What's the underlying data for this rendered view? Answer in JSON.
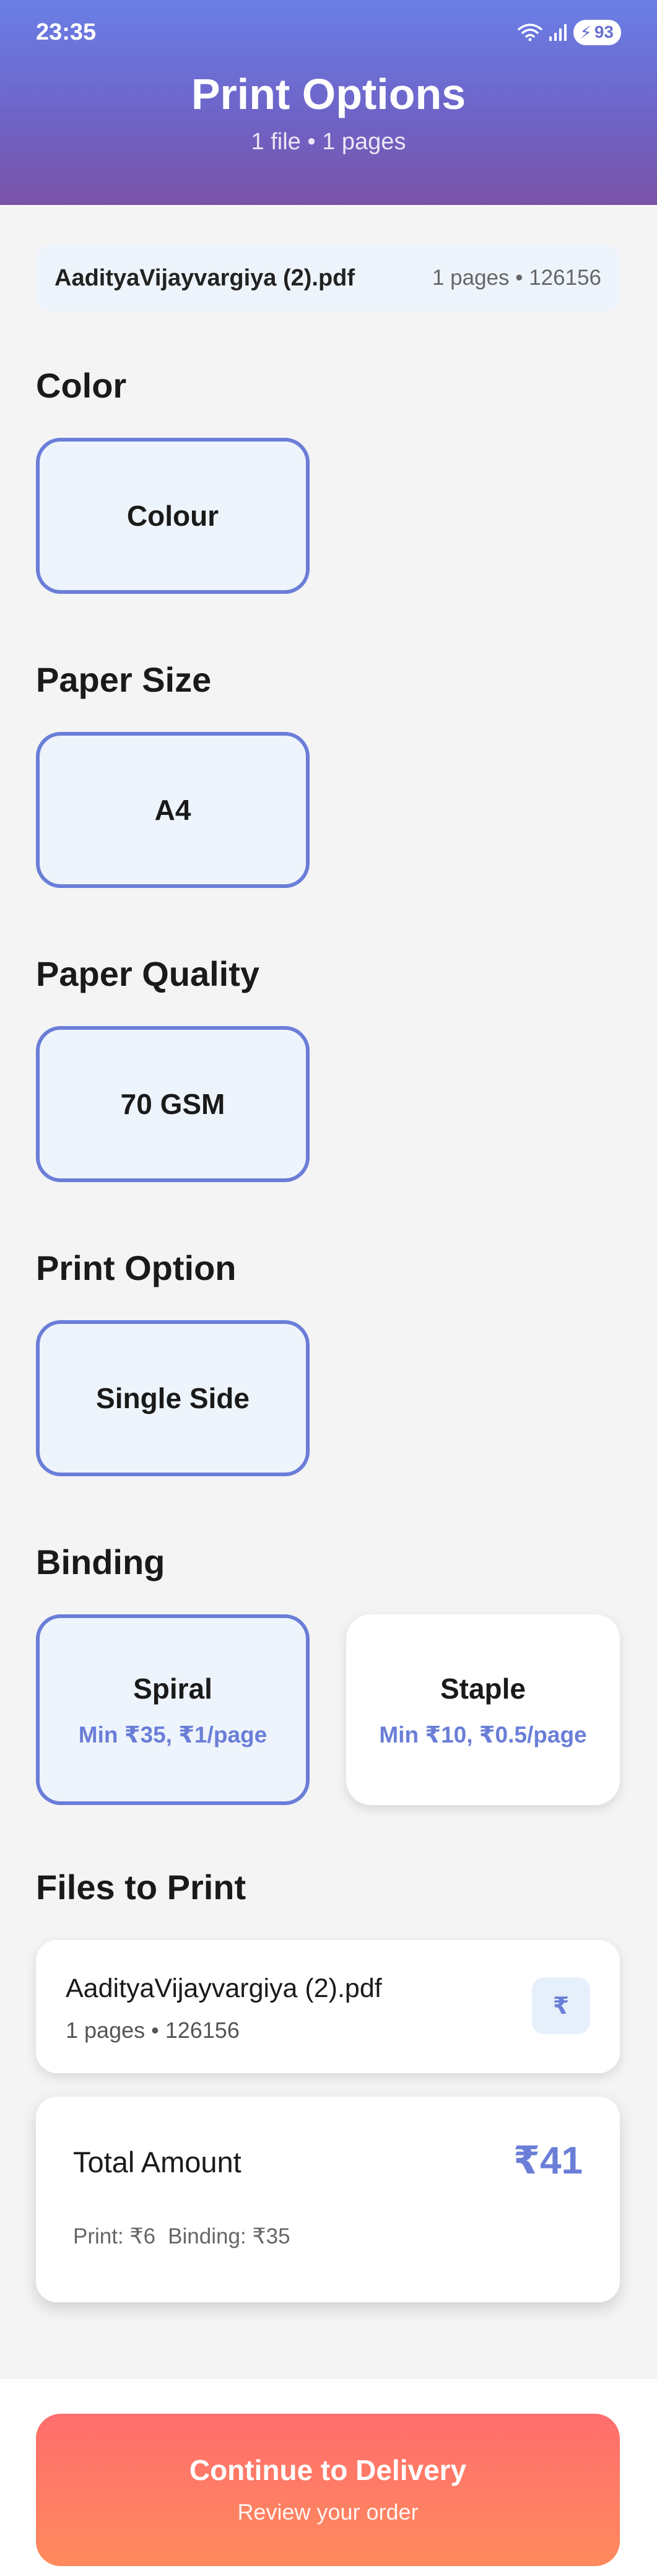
{
  "status_bar": {
    "time": "23:35",
    "battery": "93"
  },
  "header": {
    "title": "Print Options",
    "subtitle": "1 file • 1 pages"
  },
  "file_summary": {
    "name": "AadityaVijayvargiya (2).pdf",
    "meta": "1 pages • 126156"
  },
  "sections": {
    "color": {
      "title": "Color",
      "options": [
        {
          "label": "Colour",
          "selected": true
        }
      ]
    },
    "paper_size": {
      "title": "Paper Size",
      "options": [
        {
          "label": "A4",
          "selected": true
        }
      ]
    },
    "paper_quality": {
      "title": "Paper Quality",
      "options": [
        {
          "label": "70 GSM",
          "selected": true
        }
      ]
    },
    "print_option": {
      "title": "Print Option",
      "options": [
        {
          "label": "Single Side",
          "selected": true
        }
      ]
    },
    "binding": {
      "title": "Binding",
      "options": [
        {
          "label": "Spiral",
          "detail": "Min ₹35, ₹1/page",
          "selected": true
        },
        {
          "label": "Staple",
          "detail": "Min ₹10, ₹0.5/page",
          "selected": false
        }
      ]
    }
  },
  "files_to_print": {
    "title": "Files to Print",
    "files": [
      {
        "name": "AadityaVijayvargiya (2).pdf",
        "meta": "1 pages • 126156",
        "price_icon": "₹"
      }
    ]
  },
  "total": {
    "label": "Total Amount",
    "amount": "₹41",
    "print": "Print: ₹6",
    "binding": "Binding: ₹35"
  },
  "cta": {
    "title": "Continue to Delivery",
    "subtitle": "Review your order"
  },
  "colors": {
    "accent": "#6a7ed8",
    "header_top": "#6a7fe6",
    "header_bottom": "#7a52a8",
    "cta_start": "#ff6e6e",
    "cta_end": "#ff8a5c"
  }
}
